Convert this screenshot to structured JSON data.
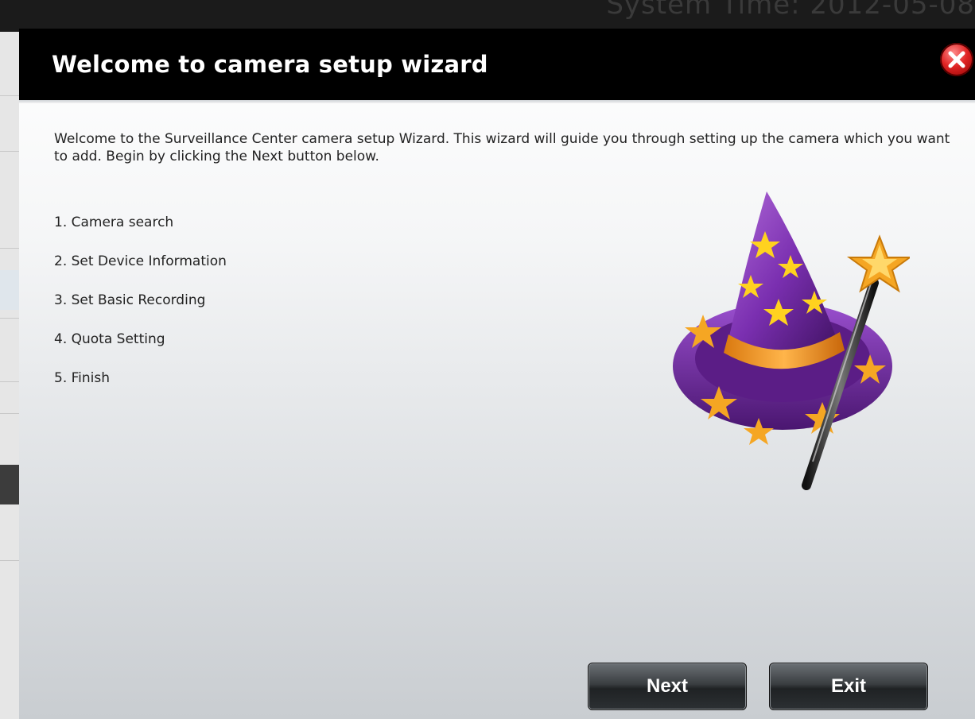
{
  "background": {
    "system_time": "System Time: 2012-05-08"
  },
  "modal": {
    "title": "Welcome to camera setup wizard",
    "intro": "Welcome to the Surveillance Center camera setup Wizard. This wizard will guide you through setting up the camera which you want to add. Begin by clicking the Next button below.",
    "steps": [
      "1. Camera search",
      "2. Set Device Information",
      "3. Set Basic Recording",
      "4. Quota Setting",
      "5. Finish"
    ],
    "close_icon": "close-icon",
    "illustration": "wizard-hat-wand-icon"
  },
  "buttons": {
    "next_label": "Next",
    "exit_label": "Exit"
  },
  "colors": {
    "header_bg": "#000000",
    "close_red": "#e02424",
    "hat_purple": "#7a2fb0",
    "star_gold": "#f5a623"
  }
}
